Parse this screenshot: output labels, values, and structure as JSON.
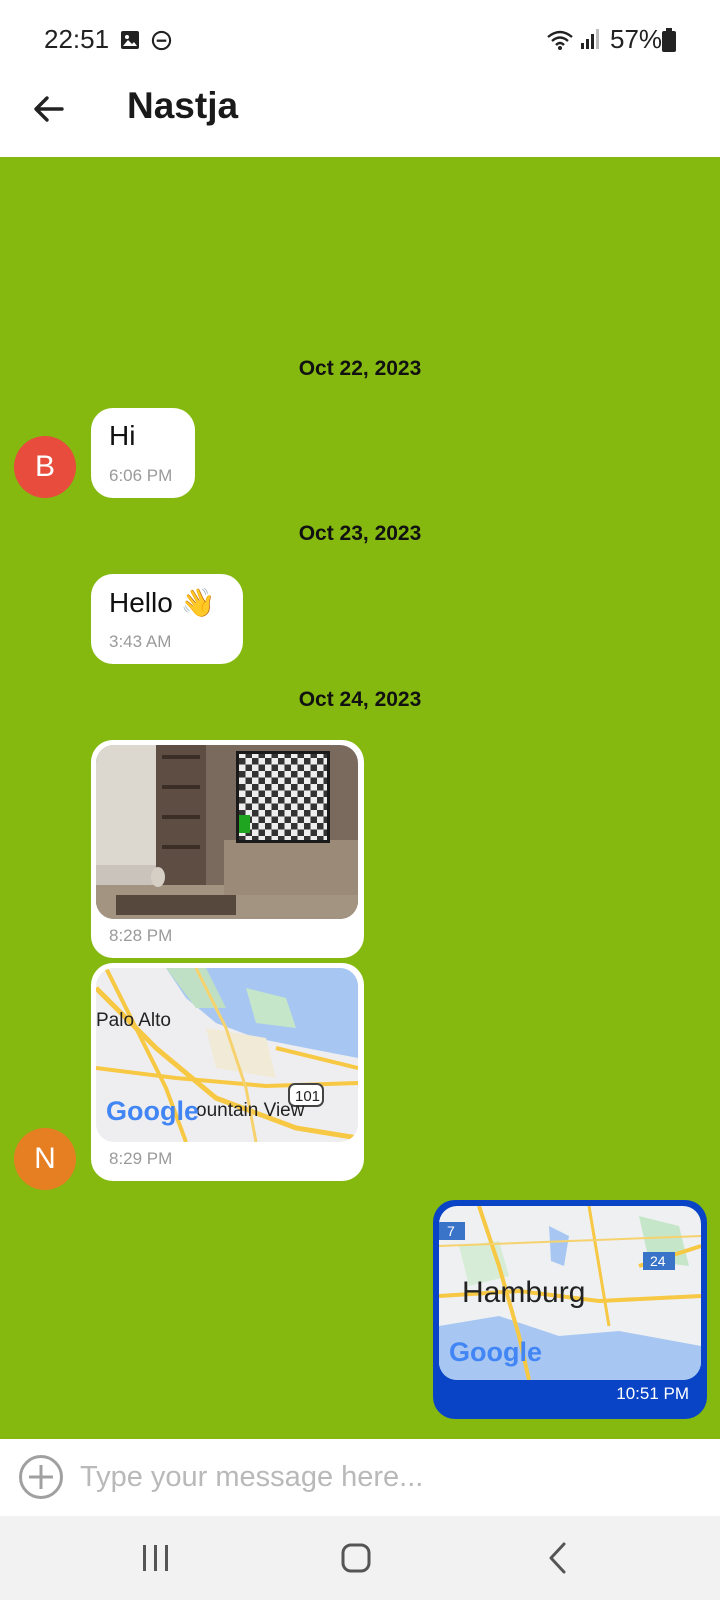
{
  "status_bar": {
    "time": "22:51",
    "battery": "57%"
  },
  "header": {
    "title": "Nastja"
  },
  "messages": [
    {
      "date": "Oct 22, 2023",
      "avatar_initial": "B",
      "avatar_color": "#e74c3c",
      "text": "Hi",
      "time": "6:06 PM"
    },
    {
      "date": "Oct 23, 2023",
      "text": "Hello 👋",
      "time": "3:43 AM"
    },
    {
      "date": "Oct 24, 2023",
      "type": "image",
      "time": "8:28 PM"
    },
    {
      "type": "map",
      "avatar_initial": "N",
      "avatar_color": "#e67e22",
      "time": "8:29 PM",
      "map_labels": {
        "city": "Palo Alto",
        "highway": "101",
        "place": "ountain View",
        "brand": "Google"
      }
    },
    {
      "type": "map",
      "outgoing": true,
      "time": "10:51 PM",
      "map_labels": {
        "city": "Hamburg",
        "road_left": "7",
        "road_right": "24",
        "brand": "Google"
      }
    }
  ],
  "input": {
    "placeholder": "Type your message here..."
  },
  "colors": {
    "chat_background": "#85b910",
    "outgoing_bubble": "#0a44c6",
    "incoming_bubble": "#ffffff"
  }
}
